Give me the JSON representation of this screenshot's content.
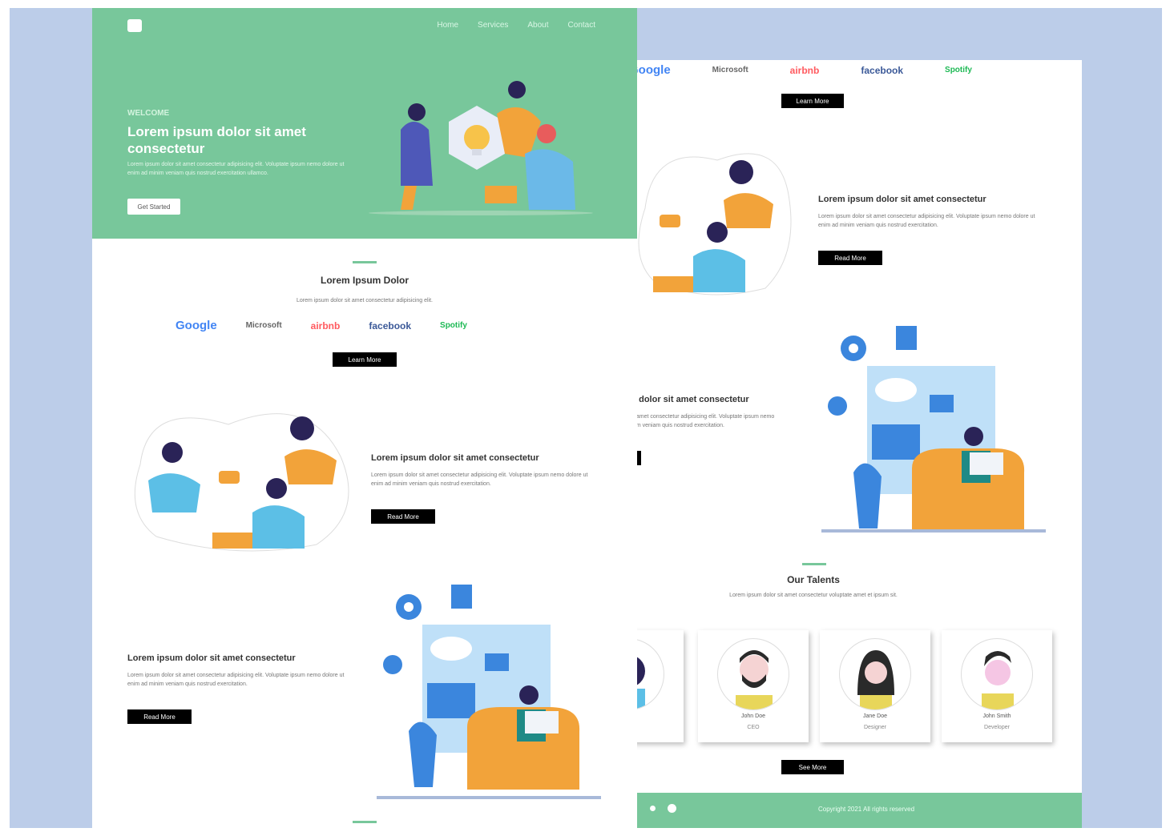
{
  "colors": {
    "accent": "#78c79b",
    "backdrop": "#bccde9",
    "button": "#000000"
  },
  "hero": {
    "logo_icon": "logo-icon",
    "nav": [
      "Home",
      "Services",
      "About",
      "Contact"
    ],
    "eyebrow": "WELCOME",
    "title": "Lorem ipsum dolor sit amet consectetur",
    "description": "Lorem ipsum dolor sit amet consectetur adipisicing elit. Voluptate ipsum nemo dolore ut enim ad minim veniam quis nostrud exercitation ullamco.",
    "button": "Get Started"
  },
  "partners": {
    "title": "Lorem Ipsum Dolor",
    "subtitle": "Lorem ipsum dolor sit amet consectetur adipisicing elit.",
    "logos": [
      "Google",
      "Microsoft",
      "airbnb",
      "facebook",
      "Spotify"
    ],
    "button": "Learn More"
  },
  "features": [
    {
      "title": "Lorem ipsum dolor sit amet consectetur",
      "text": "Lorem ipsum dolor sit amet consectetur adipisicing elit. Voluptate ipsum nemo dolore ut enim ad minim veniam quis nostrud exercitation.",
      "button": "Read More"
    },
    {
      "title": "Lorem ipsum dolor sit amet consectetur",
      "text": "Lorem ipsum dolor sit amet consectetur adipisicing elit. Voluptate ipsum nemo dolore ut enim ad minim veniam quis nostrud exercitation.",
      "button": "Read More"
    }
  ],
  "talents": {
    "title": "Our Talents",
    "subtitle": "Lorem ipsum dolor sit amet consectetur voluptate amet et ipsum sit.",
    "members": [
      {
        "name": "",
        "role": ""
      },
      {
        "name": "John Doe",
        "role": "CEO"
      },
      {
        "name": "Jane Doe",
        "role": "Designer"
      },
      {
        "name": "John Smith",
        "role": "Developer"
      }
    ],
    "button": "See More"
  },
  "footer": {
    "text": "Copyright 2021 All rights reserved"
  }
}
